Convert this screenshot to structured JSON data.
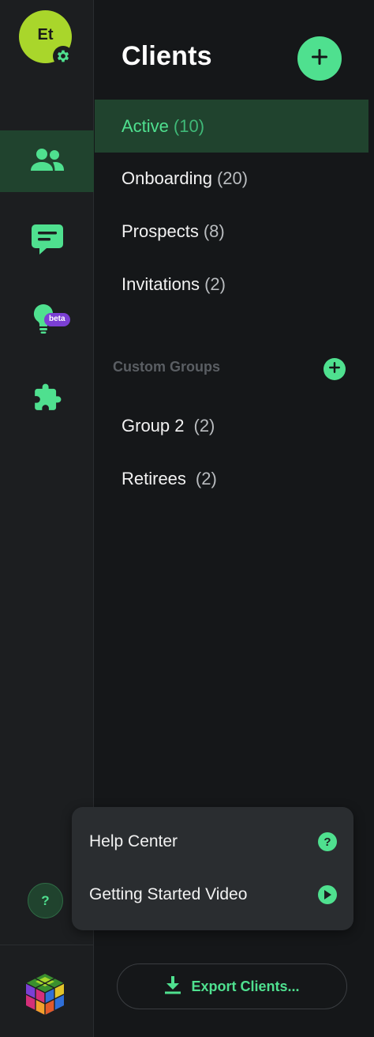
{
  "user": {
    "initials": "Et"
  },
  "rail": {
    "beta_label": "beta",
    "help_label": "?"
  },
  "header": {
    "title": "Clients"
  },
  "nav": [
    {
      "label": "Active",
      "count": "(10)"
    },
    {
      "label": "Onboarding",
      "count": "(20)"
    },
    {
      "label": "Prospects",
      "count": "(8)"
    },
    {
      "label": "Invitations",
      "count": "(2)"
    }
  ],
  "custom_groups": {
    "heading": "Custom Groups",
    "items": [
      {
        "label": "Group 2",
        "count": "(2)"
      },
      {
        "label": "Retirees",
        "count": "(2)"
      }
    ]
  },
  "help_menu": {
    "items": [
      {
        "label": "Help Center",
        "icon": "question-icon"
      },
      {
        "label": "Getting Started Video",
        "icon": "play-icon"
      }
    ]
  },
  "export": {
    "label": "Export Clients..."
  },
  "colors": {
    "accent": "#4fe08f",
    "active_bg": "#20432e",
    "avatar": "#a9d62b",
    "beta": "#7b3fd4",
    "background": "#151719"
  }
}
